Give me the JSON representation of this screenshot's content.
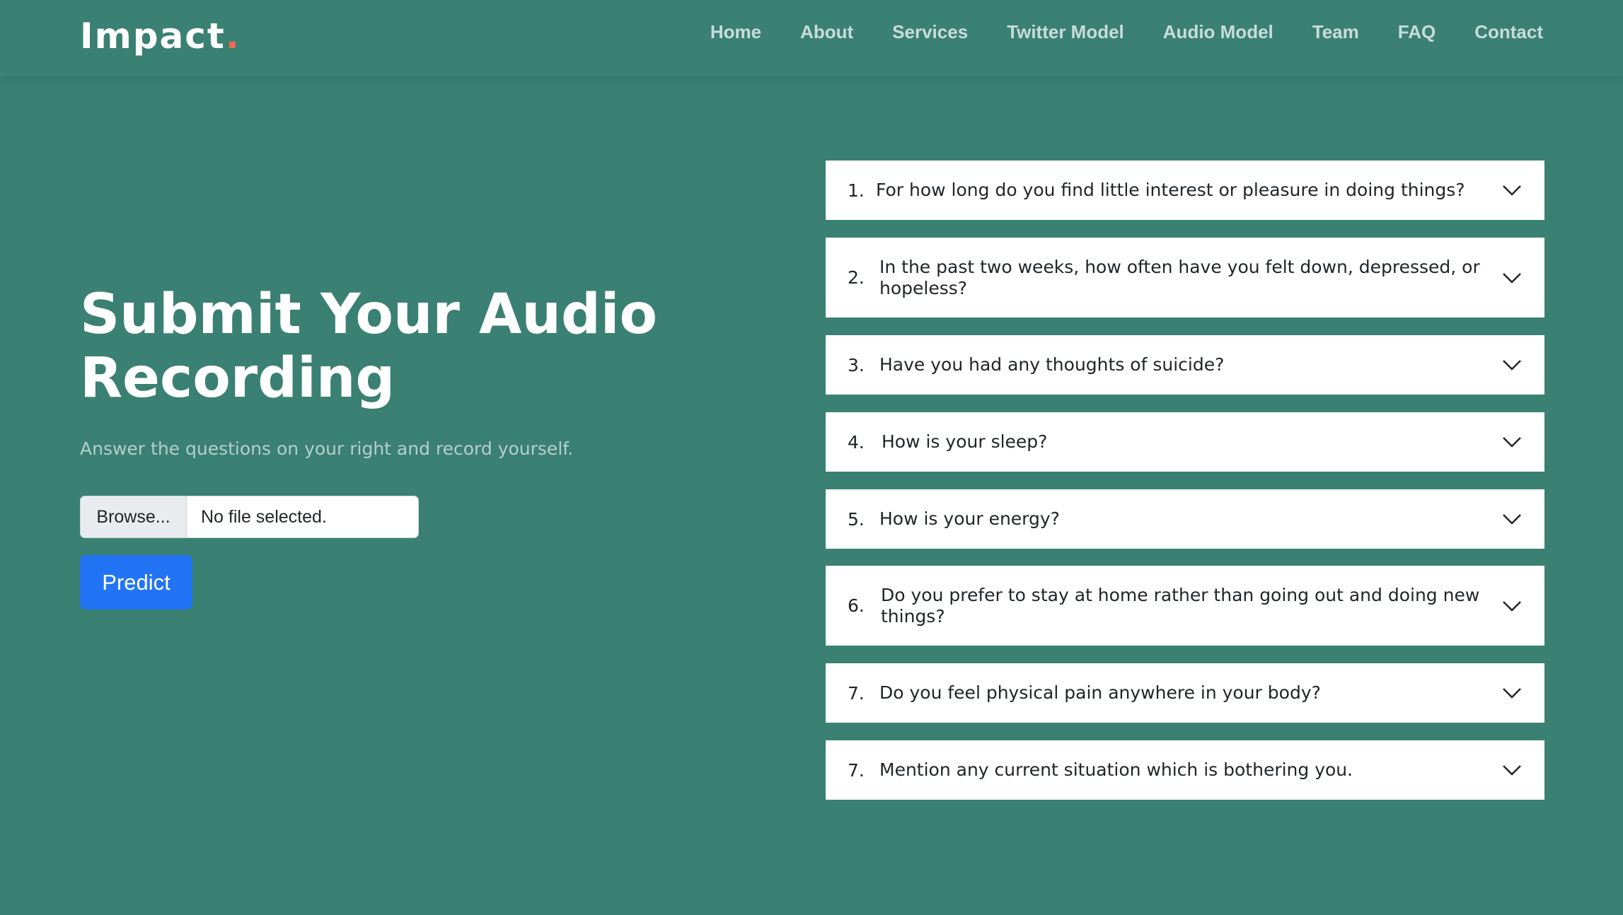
{
  "header": {
    "logo_text": "Impact",
    "logo_dot": ".",
    "nav": [
      "Home",
      "About",
      "Services",
      "Twitter Model",
      "Audio Model",
      "Team",
      "FAQ",
      "Contact"
    ]
  },
  "hero": {
    "title_line1": "Submit Your Audio",
    "title_line2": "Recording",
    "subtitle": "Answer the questions on your right and record yourself."
  },
  "upload": {
    "browse_label": "Browse...",
    "status": "No file selected.",
    "predict_label": "Predict"
  },
  "questions": [
    {
      "num": "1.",
      "text": "For how long do you find little interest or pleasure in doing things?"
    },
    {
      "num": "2.",
      "text": "In the past two weeks, how often have you felt down, depressed, or hopeless?"
    },
    {
      "num": "3.",
      "text": "Have you had any thoughts of suicide?"
    },
    {
      "num": "4.",
      "text": "How is your sleep?"
    },
    {
      "num": "5.",
      "text": "How is your energy?"
    },
    {
      "num": "6.",
      "text": "Do you prefer to stay at home rather than going out and doing new things?"
    },
    {
      "num": "7.",
      "text": "Do you feel physical pain anywhere in your body?"
    },
    {
      "num": "7.",
      "text": "Mention any current situation which is bothering you."
    }
  ],
  "colors": {
    "background": "#3a8073",
    "accent_dot": "#e96b56",
    "predict_button": "#2374f4"
  }
}
